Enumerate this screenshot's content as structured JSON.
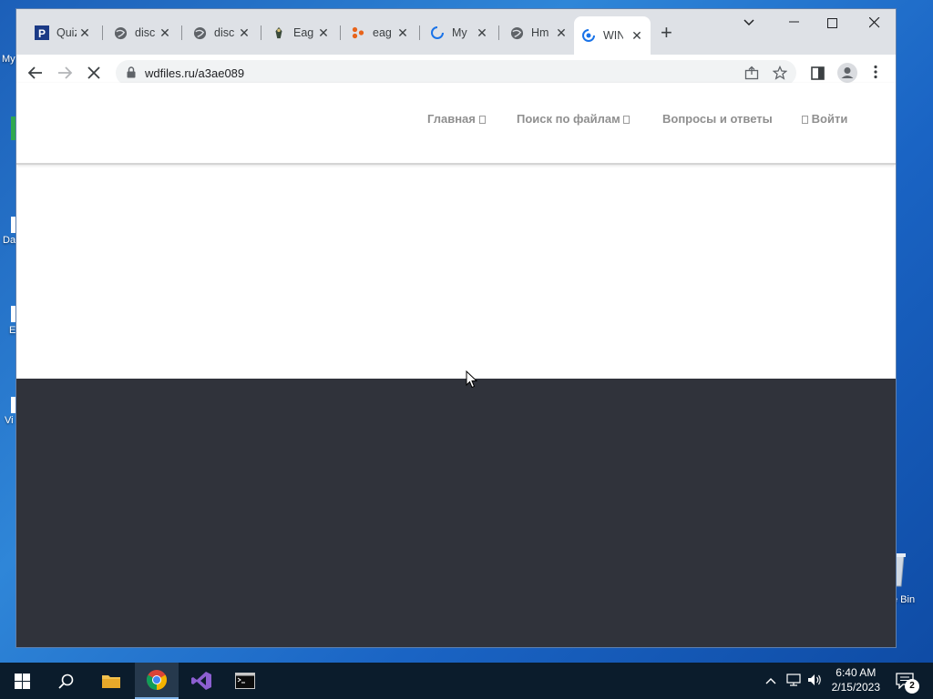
{
  "desktop": {
    "icon_labels": [
      "My",
      "Da",
      "E",
      "Vi",
      "e Bin"
    ]
  },
  "browser": {
    "tabs": [
      {
        "title": "Quiz",
        "icon": "p-logo-icon"
      },
      {
        "title": "disc",
        "icon": "globe-icon"
      },
      {
        "title": "disc",
        "icon": "globe-icon"
      },
      {
        "title": "Eag",
        "icon": "eagle-icon"
      },
      {
        "title": "eag",
        "icon": "orange-logo-icon"
      },
      {
        "title": "My",
        "icon": "loading-spinner-icon"
      },
      {
        "title": "Hm",
        "icon": "globe-icon"
      },
      {
        "title": "WIN",
        "icon": "loading-spinner-icon",
        "active": true
      }
    ],
    "address": {
      "url": "wdfiles.ru/a3ae089"
    }
  },
  "site": {
    "nav": {
      "home": "Главная",
      "search": "Поиск по файлам",
      "faq": "Вопросы и ответы",
      "login": "Войти"
    },
    "colors": {
      "nav_text": "#8f8f8f",
      "dark_section": "#30333b"
    }
  },
  "taskbar": {
    "clock": {
      "time": "6:40 AM",
      "date": "2/15/2023"
    },
    "notification_count": "2"
  }
}
